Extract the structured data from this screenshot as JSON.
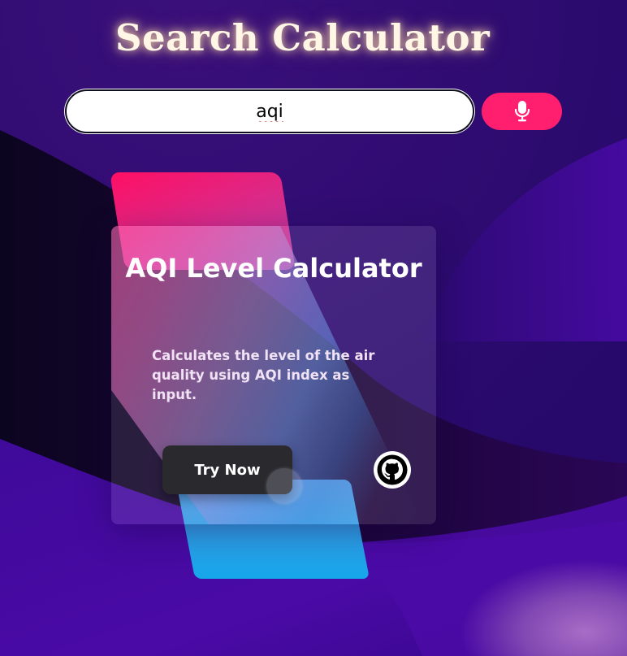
{
  "page": {
    "title": "Search Calculator"
  },
  "search": {
    "value": "aqi",
    "mic_icon": "microphone-icon"
  },
  "card": {
    "title": "AQI Level Calculator",
    "description": "Calculates the level of the air quality using AQI index as input.",
    "try_label": "Try Now",
    "github_icon": "github-icon"
  },
  "colors": {
    "background_top": "#2a0a6e",
    "background_deep": "#1a0436",
    "accent_pink": "#ff1f6e",
    "accent_blue": "#16a6ea",
    "button_dark": "#2a2a2e",
    "title_glow": "#fff6e6"
  }
}
